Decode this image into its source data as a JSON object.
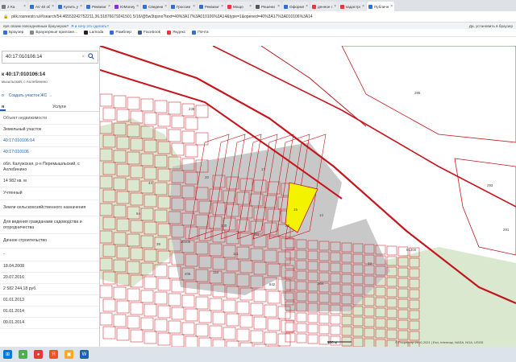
{
  "browser": {
    "tabs": [
      {
        "label": "2 Ka",
        "color": "#7a7a7a"
      },
      {
        "label": "AV 40 объявл",
        "color": "#2f6fd6"
      },
      {
        "label": "Купить уч",
        "color": "#2f6fd6"
      },
      {
        "label": "Реквизиты",
        "color": "#2f6fd6"
      },
      {
        "label": "ЮMoney",
        "color": "#8a2be2"
      },
      {
        "label": "Сведени",
        "color": "#2f6fd6"
      },
      {
        "label": "Гроссии",
        "color": "#2f6fd6"
      },
      {
        "label": "Реквизиты",
        "color": "#2f6fd6"
      },
      {
        "label": "Мощо",
        "color": "#e53935"
      },
      {
        "label": "Решени",
        "color": "#555555"
      },
      {
        "label": "Оформле",
        "color": "#2f6fd6"
      },
      {
        "label": "денное с",
        "color": "#e53935"
      },
      {
        "label": "кадастро",
        "color": "#e53935"
      },
      {
        "label": "Публичн",
        "color": "#2f6fd6"
      }
    ],
    "close_glyph": "×",
    "url": "pkk.rosreestr.ru/#/search/54.46553242752211,36.51876679241501 5/16/@5w3tqsno?text=40%3A17%3A010106%3A14&type=1&opened=40%3A17%3A010106%3A14",
    "lock_icon": "lock-icon",
    "infobar_text": "еря своим повседневным браузером?",
    "infobar_link": "Я и хочу это сделать?",
    "infobar_right": "Да, установить в браузер",
    "bookmarks": [
      {
        "label": "Браузер",
        "color": "#2f6fd6"
      },
      {
        "label": "Браузерные приложе...",
        "color": "#888888"
      },
      {
        "label": "Lamoda",
        "color": "#222222"
      },
      {
        "label": "Рамблер",
        "color": "#2f6fd6"
      },
      {
        "label": "Facebook",
        "color": "#3b5998"
      },
      {
        "label": "Яндекс",
        "color": "#e53935"
      },
      {
        "label": "Почта",
        "color": "#2f6fd6"
      }
    ]
  },
  "panel": {
    "search_value": "40:17:010106:14",
    "clear_glyph": "×",
    "search_icon": "search-icon",
    "title": "к 40:17:010106:14",
    "address": "мышльский, с Ахлебинино",
    "actions": [
      "о",
      "Создать участок ЖС →"
    ],
    "tabs": [
      "я",
      "Услуги"
    ],
    "rows": [
      {
        "text": "Объект недвижимости",
        "kind": "lbl"
      },
      {
        "text": "Земельный участок",
        "kind": "val"
      },
      {
        "text": "40:17:010106:14",
        "kind": "link"
      },
      {
        "text": "40:17:010106",
        "kind": "link"
      },
      {
        "text": "обл. Калужская, р-н Перемышльский, с Ахлебинино",
        "kind": "val"
      },
      {
        "text": "14 982 кв. м",
        "kind": "val"
      },
      {
        "text": "Учтенный",
        "kind": "val"
      },
      {
        "text": "Земли сельскохозяйственного назначения",
        "kind": "val"
      },
      {
        "text": "Для ведения гражданами садоводства и огородничества",
        "kind": "val"
      },
      {
        "text": "Дачное строительство",
        "kind": "val"
      },
      {
        "text": "-",
        "kind": "val"
      },
      {
        "text": "18.04.2008",
        "kind": "val"
      },
      {
        "text": "20.07.2016",
        "kind": "val"
      },
      {
        "text": "2 582 244,18 руб.",
        "kind": "val"
      },
      {
        "text": "01.01.2013",
        "kind": "val"
      },
      {
        "text": "01.01.2014",
        "kind": "val"
      },
      {
        "text": "09.01.2014",
        "kind": "val"
      }
    ]
  },
  "map": {
    "parcel_labels": [
      {
        "t": "238"
      },
      {
        "t": "295"
      },
      {
        "t": "293"
      },
      {
        "t": "291"
      },
      {
        "t": "81300"
      },
      {
        "t": "12"
      },
      {
        "t": "17"
      },
      {
        "t": "20"
      },
      {
        "t": "25"
      },
      {
        "t": "15"
      },
      {
        "t": "14"
      },
      {
        "t": "200"
      },
      {
        "t": "10106"
      },
      {
        "t": "842"
      },
      {
        "t": "111"
      },
      {
        "t": "201"
      },
      {
        "t": "205"
      },
      {
        "t": "204"
      },
      {
        "t": "44"
      },
      {
        "t": "64"
      },
      {
        "t": "38"
      },
      {
        "t": "118"
      }
    ],
    "scale_text": "100 м",
    "copyright": "© Росреестр 2010-2021 | Esri, Intermap, NASA, NGA, USGS"
  },
  "taskbar": {
    "apps": [
      {
        "name": "start-icon",
        "color": "#0078d4",
        "glyph": "⊞"
      },
      {
        "name": "chrome-icon",
        "color": "#4caf50",
        "glyph": "●"
      },
      {
        "name": "browser-icon",
        "color": "#e53935",
        "glyph": "●"
      },
      {
        "name": "yandex-icon",
        "color": "#f4511e",
        "glyph": "Я"
      },
      {
        "name": "files-icon",
        "color": "#f9a825",
        "glyph": "▣"
      },
      {
        "name": "word-icon",
        "color": "#1e5fb4",
        "glyph": "W"
      }
    ],
    "tray_time": "",
    "tray_lang": ""
  },
  "colors": {
    "parcel_stroke": "#c4161c",
    "selected_fill": "#f3f300",
    "gray_fill": "#c8c8c8",
    "green_fill": "#dbe8d0"
  }
}
